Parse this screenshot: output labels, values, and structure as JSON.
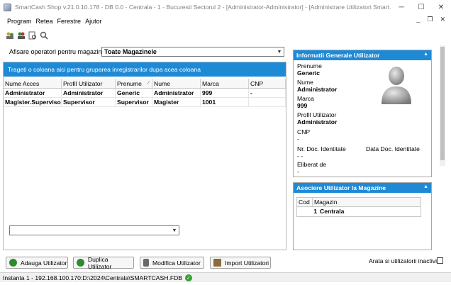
{
  "window": {
    "title": "SmartCash Shop v.21.0.10.178 - DB 0.0 - Centrala - 1 - Bucuresti Sectorul 2 - [Administrator-Administrator] - [Administrare Utilizatori Smart...",
    "minimize": "─",
    "maximize": "☐",
    "close": "✕"
  },
  "menu": [
    "Program",
    "Retea",
    "Ferestre",
    "Ajutor"
  ],
  "mdi": {
    "minimize": "_",
    "restore": "❐",
    "close": "✕"
  },
  "filter": {
    "label": "Afisare operatori pentru magazinul",
    "value": "Toate Magazinele"
  },
  "grid": {
    "group_hint": "Trageti o coloana aici pentru gruparea inregistrarilor dupa acea coloana",
    "columns": [
      "Nume Acces",
      "Profil Utilizator",
      "Prenume",
      "Nume",
      "Marca",
      "CNP"
    ],
    "rows": [
      [
        "Administrator",
        "Administrator",
        "Generic",
        "Administrator",
        "999",
        "-"
      ],
      [
        "Magister.Supervisor",
        "Supervisor",
        "Supervisor",
        "Magister",
        "1001",
        ""
      ]
    ]
  },
  "info_panel": {
    "title": "Informatii Generale Utilizator",
    "prenume_label": "Prenume",
    "prenume": "Generic",
    "nume_label": "Nume",
    "nume": "Administrator",
    "marca_label": "Marca",
    "marca": "999",
    "profil_label": "Profil Utilizator",
    "profil": "Administrator",
    "cnp_label": "CNP",
    "cnp": "-",
    "nr_doc_label": "Nr. Doc. Identitate",
    "nr_doc": "- -",
    "data_doc_label": "Data Doc. Identitate",
    "eliberat_label": "Eliberat de",
    "eliberat": "-"
  },
  "stores_panel": {
    "title": "Asociere Utilizator la Magazine",
    "columns": [
      "Cod",
      "Magazin"
    ],
    "rows": [
      [
        "1",
        "Centrala"
      ]
    ]
  },
  "buttons": {
    "add": "Adauga Utilizator",
    "duplicate": "Duplica Utilizator",
    "edit": "Modifica Utilizator",
    "import": "Import Utilizatori"
  },
  "show_inactive_label": "Arata si utilizatorii inactivi",
  "status": "Instanta 1 - 192.168.100.170:D:\\2024\\Centrala\\SMARTCASH.FDB"
}
